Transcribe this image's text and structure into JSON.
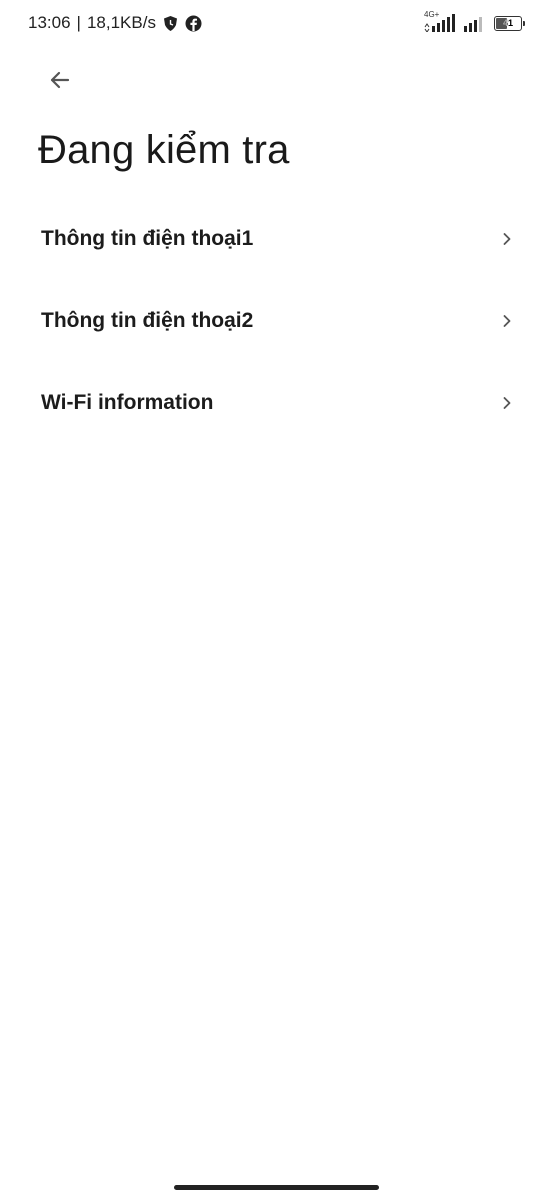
{
  "status_bar": {
    "time": "13:06",
    "separator": "|",
    "net_speed": "18,1KB/s",
    "notification_icons": [
      "shield-icon",
      "facebook-icon"
    ],
    "network_type": "4G+",
    "battery_level": "41"
  },
  "header": {
    "back_icon": "arrow-left-icon",
    "title": "Đang kiểm tra"
  },
  "menu": {
    "items": [
      {
        "label": "Thông tin điện thoại1",
        "icon": "chevron-right-icon"
      },
      {
        "label": "Thông tin điện thoại2",
        "icon": "chevron-right-icon"
      },
      {
        "label": "Wi-Fi information",
        "icon": "chevron-right-icon"
      }
    ]
  },
  "colors": {
    "background": "#ffffff",
    "text_primary": "#1a1a1a",
    "chevron": "#555555",
    "home_indicator": "#222222"
  }
}
